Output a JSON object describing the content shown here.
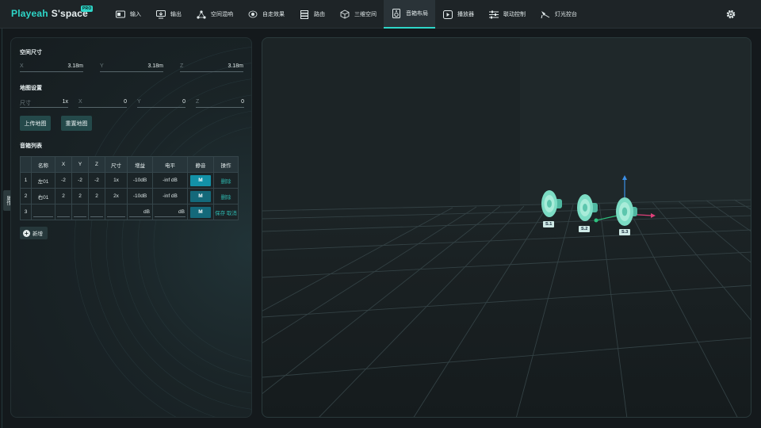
{
  "app": {
    "logo_main": "Playeah",
    "logo_space": "S'space",
    "logo_badge": "PRO"
  },
  "nav": [
    {
      "label": "输入",
      "icon": "input-icon"
    },
    {
      "label": "输出",
      "icon": "output-icon"
    },
    {
      "label": "空间混响",
      "icon": "reverb-icon"
    },
    {
      "label": "自走效果",
      "icon": "auto-move-icon"
    },
    {
      "label": "路由",
      "icon": "routing-icon"
    },
    {
      "label": "三维空间",
      "icon": "cube-icon"
    },
    {
      "label": "音箱布局",
      "icon": "speaker-icon",
      "active": true
    },
    {
      "label": "播放器",
      "icon": "play-icon"
    },
    {
      "label": "联动控制",
      "icon": "sliders-icon"
    },
    {
      "label": "灯光控台",
      "icon": "light-icon"
    }
  ],
  "side_tab": "属性",
  "space": {
    "title": "空间尺寸",
    "x_label": "X",
    "x_value": "3.18m",
    "y_label": "Y",
    "y_value": "3.18m",
    "z_label": "Z",
    "z_value": "3.18m"
  },
  "map": {
    "title": "地图设置",
    "size_label": "尺寸",
    "size_value": "1x",
    "x_label": "X",
    "x_value": "0",
    "y_label": "Y",
    "y_value": "0",
    "z_label": "Z",
    "z_value": "0",
    "upload_label": "上传地图",
    "reset_label": "重置地图"
  },
  "speakers": {
    "title": "音箱列表",
    "headers": [
      "名称",
      "X",
      "Y",
      "Z",
      "尺寸",
      "增益",
      "电平",
      "静音",
      "操作"
    ],
    "rows": [
      {
        "index": "1",
        "name": "左01",
        "x": "-2",
        "y": "-2",
        "z": "-2",
        "size": "1x",
        "gain": "-10dB",
        "level": "-inf dB",
        "mute": "M",
        "action": "删除"
      },
      {
        "index": "2",
        "name": "右01",
        "x": "2",
        "y": "2",
        "z": "2",
        "size": "2x",
        "gain": "-10dB",
        "level": "-inf dB",
        "mute": "M",
        "action": "删除"
      }
    ],
    "new_row": {
      "index": "3",
      "gain_unit": "dB",
      "level_unit": "dB",
      "mute": "M",
      "save": "保存",
      "cancel": "取消"
    },
    "add_label": "新增"
  },
  "scene": {
    "labels": [
      "S.1",
      "S.2",
      "S.3"
    ],
    "colors": {
      "accent": "#2ed6c8",
      "speaker": "#5fd1b8",
      "axis_x": "#e0407a",
      "axis_y": "#3b8fe6",
      "axis_z": "#2ec27e"
    }
  }
}
